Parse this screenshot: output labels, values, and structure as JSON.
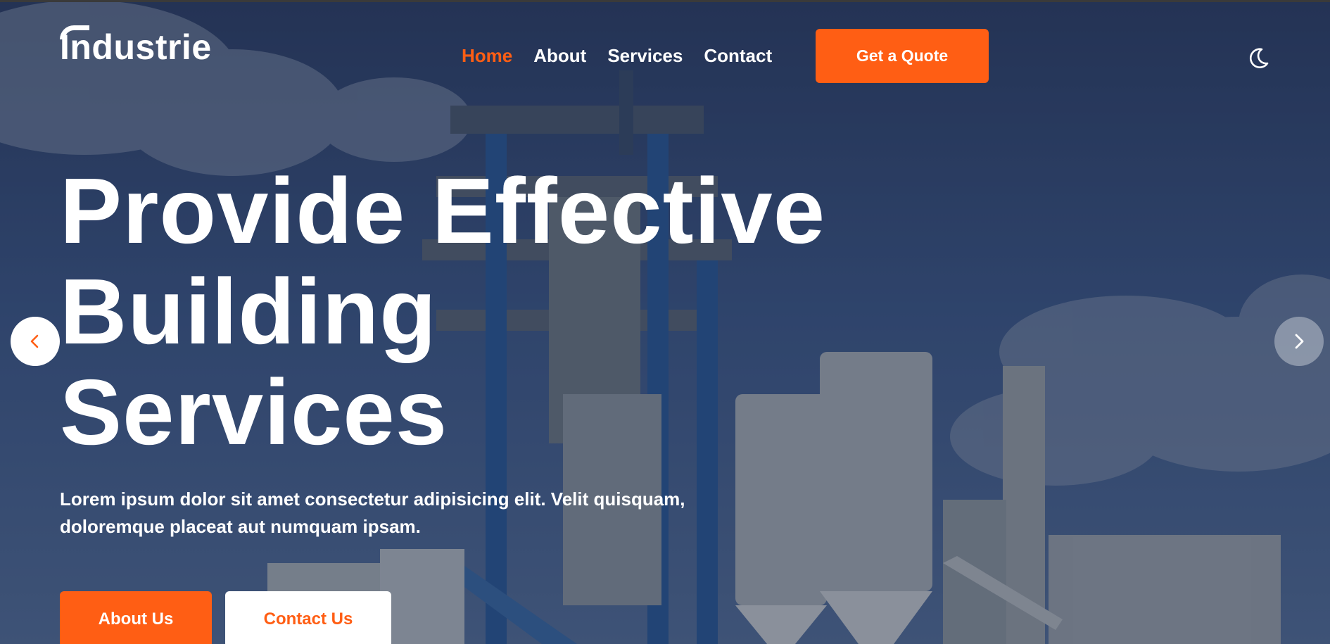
{
  "brand": {
    "logo_text": "Industrie"
  },
  "nav": {
    "items": [
      {
        "label": "Home",
        "active": true
      },
      {
        "label": "About",
        "active": false
      },
      {
        "label": "Services",
        "active": false
      },
      {
        "label": "Contact",
        "active": false
      }
    ],
    "cta_label": "Get a Quote",
    "theme_toggle_icon": "moon-icon"
  },
  "hero": {
    "headline_line1": "Provide Effective",
    "headline_line2": "Building",
    "headline_line3": "Services",
    "subtext": "Lorem ipsum dolor sit amet consectetur adipisicing elit. Velit quisquam, doloremque placeat aut numquam ipsam.",
    "primary_button": "About Us",
    "secondary_button": "Contact Us"
  },
  "carousel": {
    "prev_icon": "chevron-left-icon",
    "next_icon": "chevron-right-icon"
  },
  "colors": {
    "accent": "#ff5e14",
    "text": "#ffffff"
  }
}
